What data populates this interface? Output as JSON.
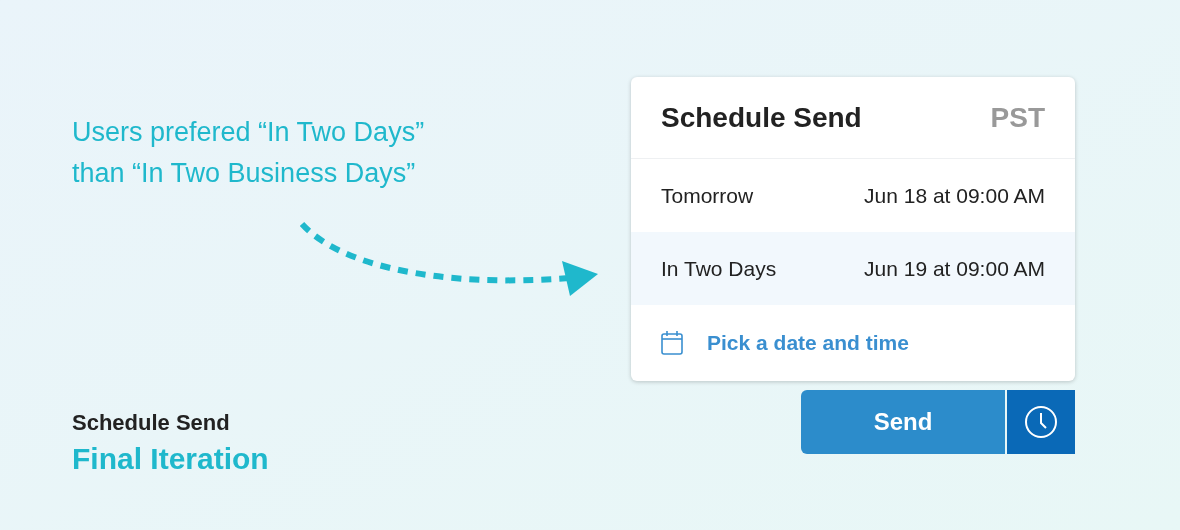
{
  "note": {
    "lines": [
      "Users prefered “In Two Days”",
      "than “In Two Business Days”"
    ]
  },
  "caption": {
    "title": "Schedule Send",
    "subtitle": "Final Iteration"
  },
  "panel": {
    "title": "Schedule Send",
    "timezone": "PST",
    "options": [
      {
        "label": "Tomorrow",
        "time": "Jun 18 at 09:00 AM",
        "selected": false
      },
      {
        "label": "In Two Days",
        "time": "Jun 19 at 09:00 AM",
        "selected": true
      }
    ],
    "pick_link": "Pick a date and time"
  },
  "send_button": "Send"
}
